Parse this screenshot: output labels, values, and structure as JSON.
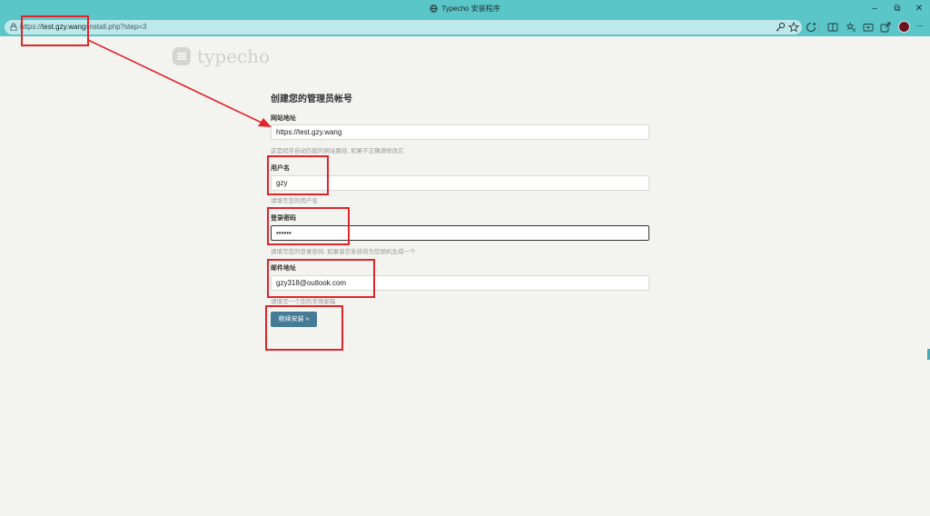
{
  "window": {
    "title": "Typecho 安装程序",
    "minimize": "–",
    "maximize": "⧉",
    "close": "✕"
  },
  "browser": {
    "url_scheme": "https://",
    "url_host": "test.gzy.wang",
    "url_path": "/install.php?step=3",
    "more": "···"
  },
  "logo": {
    "text": "typecho"
  },
  "form": {
    "heading": "创建您的管理员帐号",
    "site_url": {
      "label": "网站地址",
      "value": "https://test.gzy.wang",
      "hint": "这是程序自动匹配的网站路径, 如果不正确请修改它"
    },
    "username": {
      "label": "用户名",
      "value": "gzy",
      "hint": "请填写您的用户名"
    },
    "password": {
      "label": "登录密码",
      "value": "••••••",
      "hint": "请填写您的登录密码, 如果留空系统将为您随机生成一个"
    },
    "email": {
      "label": "邮件地址",
      "value": "gzy318@outlook.com",
      "hint": "请填写一个您的常用邮箱"
    },
    "submit_label": "继续安装 »"
  },
  "colors": {
    "browser_chrome": "#5bc6c8",
    "annotation": "#e0242a",
    "button": "#467b96"
  }
}
